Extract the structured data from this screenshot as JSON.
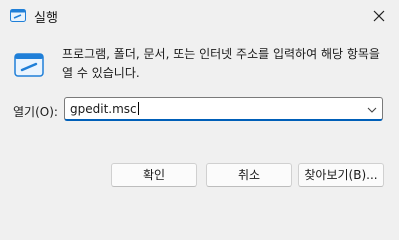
{
  "window": {
    "title": "실행"
  },
  "description": "프로그램, 폴더, 문서, 또는 인터넷 주소를 입력하여 해당 항목을 열 수 있습니다.",
  "open_field": {
    "label": "열기(O):",
    "value": "gpedit.msc"
  },
  "buttons": {
    "ok": "확인",
    "cancel": "취소",
    "browse": "찾아보기(B)..."
  },
  "icons": {
    "title": "run-icon",
    "close": "close-icon",
    "dropdown": "chevron-down-icon",
    "description": "run-app-icon"
  },
  "colors": {
    "accent": "#005fb8",
    "icon_blue": "#1f7fd8"
  }
}
